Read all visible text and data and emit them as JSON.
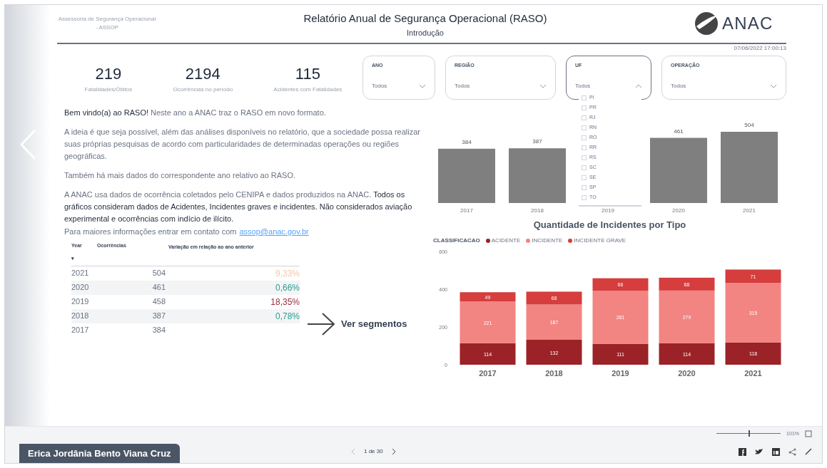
{
  "header": {
    "org": "Assessoria de Segurança Operacional - ASSOP",
    "title": "Relatório Anual de Segurança Operacional (RASO)",
    "subtitle": "Introdução",
    "logo_text": "ANAC",
    "timestamp": "07/06/2022 17:00:13"
  },
  "kpis": [
    {
      "value": "219",
      "label": "Fatalidades/Óbitos"
    },
    {
      "value": "2194",
      "label": "Ocorrências no período"
    },
    {
      "value": "115",
      "label": "Acidentes com Fatalidades"
    }
  ],
  "filters": [
    {
      "label": "ANO",
      "value": "Todos",
      "expanded": false
    },
    {
      "label": "REGIÃO",
      "value": "Todos",
      "expanded": false
    },
    {
      "label": "UF",
      "value": "Todos",
      "expanded": true,
      "options": [
        {
          "label": "PI",
          "checked": false
        },
        {
          "label": "PR",
          "checked": false
        },
        {
          "label": "RJ",
          "checked": false
        },
        {
          "label": "RN",
          "checked": false
        },
        {
          "label": "RO",
          "checked": false
        },
        {
          "label": "RR",
          "checked": false
        },
        {
          "label": "RS",
          "checked": false
        },
        {
          "label": "SC",
          "checked": false
        },
        {
          "label": "SE",
          "checked": false
        },
        {
          "label": "SP",
          "checked": false
        },
        {
          "label": "TO",
          "checked": false
        }
      ]
    },
    {
      "label": "OPERAÇÃO",
      "value": "Todos",
      "expanded": false
    }
  ],
  "intro": [
    "**Bem vindo(a) ao RASO!** Neste ano a ANAC traz o RASO em novo formato.",
    "A ideia é que seja possível, além das análises disponíveis no relatório, que a sociedade possa realizar suas próprias pesquisas de acordo com particularidades de determinadas operações ou regiões geográficas.",
    "Também há mais dados do correspondente ano relativo ao RASO.",
    "A ANAC usa dados de ocorrência coletados pelo CENIPA e dados produzidos na ANAC. **Todos os gráficos consideram dados de Acidentes, Incidentes graves e incidentes. Não considerados aviação experimental e ocorrências com indício de ilícito.**"
  ],
  "contact": {
    "text": "Para maiores informações entrar em contato com",
    "link": "assop@anac.gov.br"
  },
  "table": {
    "columns": [
      "Year",
      "Ocorrências",
      "Variação em relação ao ano anterior"
    ],
    "sort_icon": "▾",
    "rows": [
      {
        "year": "2021",
        "count": "504",
        "variation": "9,33%",
        "color": "#f5c9a8"
      },
      {
        "year": "2020",
        "count": "461",
        "variation": "0,66%",
        "color": "#2a9d8f"
      },
      {
        "year": "2019",
        "count": "458",
        "variation": "18,35%",
        "color": "#9b2d3a"
      },
      {
        "year": "2018",
        "count": "387",
        "variation": "0,78%",
        "color": "#2a9d8f"
      },
      {
        "year": "2017",
        "count": "384"
      }
    ]
  },
  "segments_link": "Ver segmentos",
  "top_chart": {
    "chart_data": {
      "type": "bar",
      "categories": [
        "2017",
        "2018",
        "2019",
        "2020",
        "2021"
      ],
      "values": [
        384,
        387,
        null,
        461,
        504
      ],
      "data_labels": true
    }
  },
  "bottom_chart": {
    "legend_title": "CLASSIFICACAO",
    "chart_data": {
      "type": "bar",
      "title": "Quantidade de Incidentes por Tipo",
      "stacked": true,
      "categories": [
        "2017",
        "2018",
        "2019",
        "2020",
        "2021"
      ],
      "yticks": [
        0,
        200,
        400,
        600
      ],
      "ylim": [
        0,
        600
      ],
      "data_labels": true,
      "series": [
        {
          "name": "ACIDENTE",
          "color": "#9b2226",
          "values": [
            114,
            132,
            111,
            114,
            118
          ]
        },
        {
          "name": "INCIDENTE",
          "color": "#f28482",
          "values": [
            221,
            187,
            281,
            279,
            315
          ]
        },
        {
          "name": "INCIDENTE GRAVE",
          "color": "#d63d3d",
          "values": [
            49,
            68,
            66,
            68,
            71
          ]
        }
      ]
    }
  },
  "viewer": {
    "zoom": "101%",
    "zoom_slider": {
      "level": 0.5
    },
    "page": "1 de 30",
    "user": "Erica Jordânia Bento Viana Cruz"
  }
}
